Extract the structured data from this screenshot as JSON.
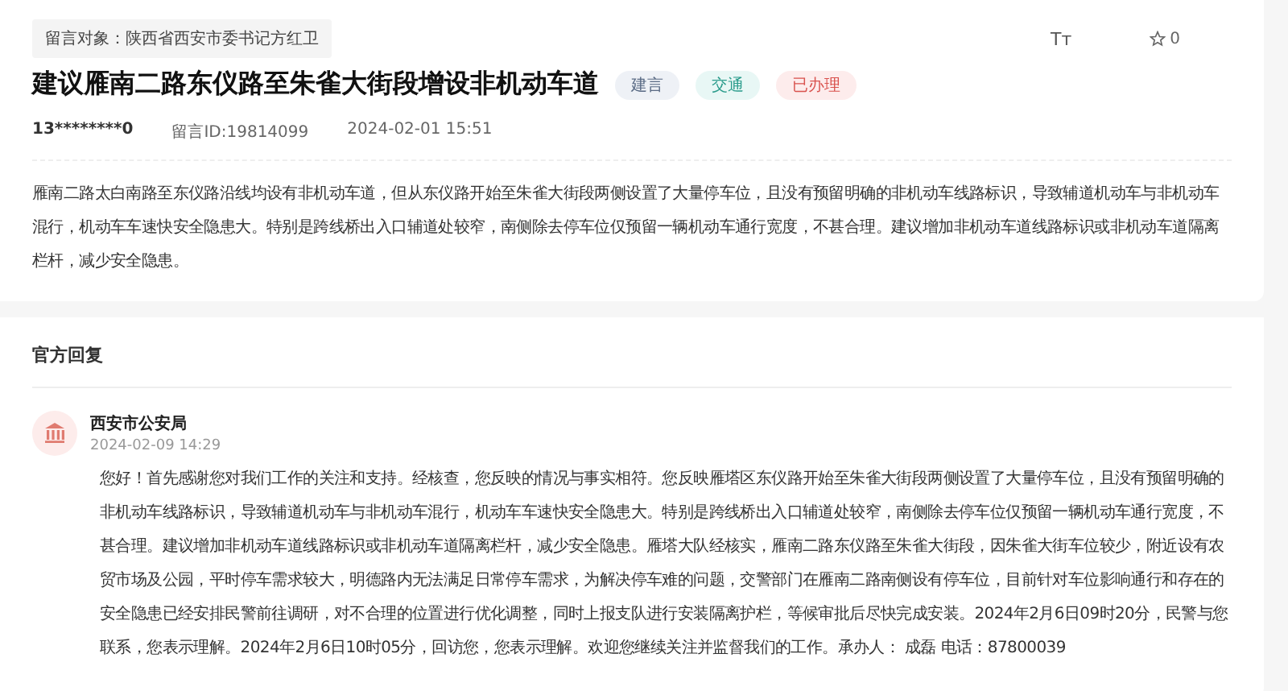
{
  "header": {
    "recipient": "留言对象：陕西省西安市委书记方红卫",
    "font_size_label": "Tт",
    "star_count": "0"
  },
  "message": {
    "title": "建议雁南二路东仪路至朱雀大街段增设非机动车道",
    "tags": [
      {
        "label": "建言",
        "color": "#eef1f6"
      },
      {
        "label": "交通",
        "color": "#e8f7f5"
      },
      {
        "label": "已办理",
        "color": "#fdecec"
      }
    ],
    "author": "13********0",
    "message_id": "留言ID:19814099",
    "time": "2024-02-01 15:51",
    "body": "雁南二路太白南路至东仪路沿线均设有非机动车道，但从东仪路开始至朱雀大街段两侧设置了大量停车位，且没有预留明确的非机动车线路标识，导致辅道机动车与非机动车混行，机动车车速快安全隐患大。特别是跨线桥出入口辅道处较窄，南侧除去停车位仅预留一辆机动车通行宽度，不甚合理。建议增加非机动车道线路标识或非机动车道隔离栏杆，减少安全隐患。"
  },
  "reply": {
    "heading": "官方回复",
    "department": "西安市公安局",
    "time": "2024-02-09 14:29",
    "body": "您好！首先感谢您对我们工作的关注和支持。经核查，您反映的情况与事实相符。您反映雁塔区东仪路开始至朱雀大街段两侧设置了大量停车位，且没有预留明确的非机动车线路标识，导致辅道机动车与非机动车混行，机动车车速快安全隐患大。特别是跨线桥出入口辅道处较窄，南侧除去停车位仅预留一辆机动车通行宽度，不甚合理。建议增加非机动车道线路标识或非机动车道隔离栏杆，减少安全隐患。雁塔大队经核实，雁南二路东仪路至朱雀大街段，因朱雀大街车位较少，附近设有农贸市场及公园，平时停车需求较大，明德路内无法满足日常停车需求，为解决停车难的问题，交警部门在雁南二路南侧设有停车位，目前针对车位影响通行和存在的安全隐患已经安排民警前往调研，对不合理的位置进行优化调整，同时上报支队进行安装隔离护栏，等候审批后尽快完成安装。2024年2月6日09时20分，民警与您联系，您表示理解。2024年2月6日10时05分，回访您，您表示理解。欢迎您继续关注并监督我们的工作。承办人： 成磊 电话：87800039"
  }
}
